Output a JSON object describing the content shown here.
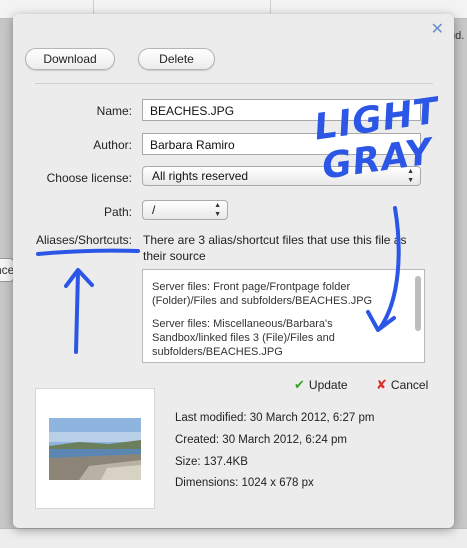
{
  "background": {
    "left_button_fragment": "nce",
    "right_text_fragment": "ud."
  },
  "dialog": {
    "close_symbol": "✕",
    "buttons": {
      "download": "Download",
      "delete": "Delete"
    },
    "form": {
      "name_label": "Name:",
      "name_value": "BEACHES.JPG",
      "author_label": "Author:",
      "author_value": "Barbara Ramiro",
      "license_label": "Choose license:",
      "license_value": "All rights reserved",
      "path_label": "Path:",
      "path_value": "/",
      "aliases_label": "Aliases/Shortcuts:",
      "aliases_text": "There are 3 alias/shortcut files that use this file as their source",
      "alias_files": [
        "Server files: Front page/Frontpage folder (Folder)/Files and subfolders/BEACHES.JPG",
        "Server files: Miscellaneous/Barbara's Sandbox/linked files 3 (File)/Files and subfolders/BEACHES.JPG"
      ]
    },
    "actions": {
      "update": "Update",
      "cancel": "Cancel"
    },
    "details": {
      "last_modified": "Last modified: 30 March 2012, 6:27 pm",
      "created": "Created: 30 March 2012, 6:24 pm",
      "size": "Size: 137.4KB",
      "dimensions": "Dimensions: 1024 x 678 px"
    }
  },
  "annotation": {
    "line1": "LIGHT",
    "line2": "GRAY",
    "color": "#2b56e6"
  }
}
